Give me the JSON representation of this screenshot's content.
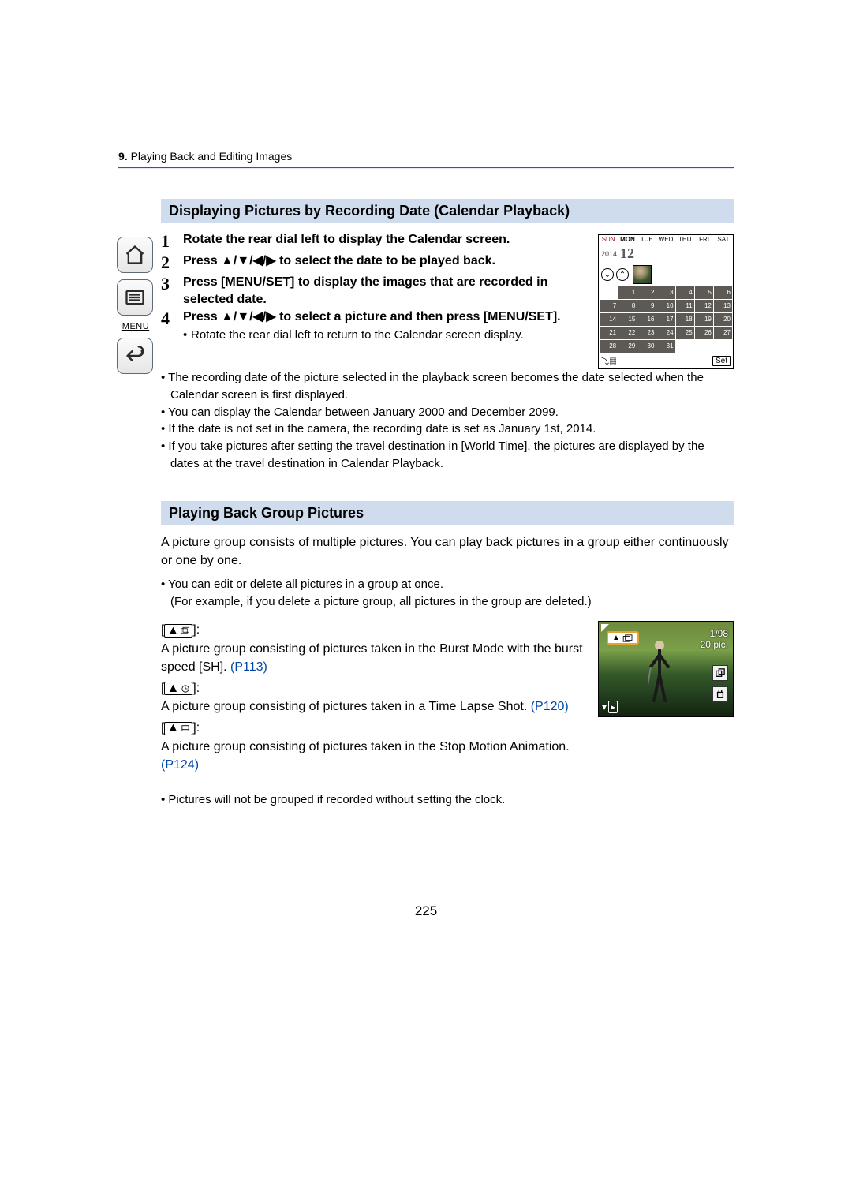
{
  "header": {
    "chapter_num": "9.",
    "chapter_title": "Playing Back and Editing Images"
  },
  "sidebar": {
    "menu_label": "MENU"
  },
  "section1": {
    "title": "Displaying Pictures by Recording Date (Calendar Playback)",
    "steps": [
      {
        "n": "1",
        "text": "Rotate the rear dial left to display the Calendar screen."
      },
      {
        "n": "2",
        "text": "Press ▲/▼/◀/▶ to select the date to be played back."
      },
      {
        "n": "3",
        "text": "Press [MENU/SET] to display the images that are recorded in selected date."
      },
      {
        "n": "4",
        "text": "Press ▲/▼/◀/▶ to select a picture and then press [MENU/SET].",
        "sub": "Rotate the rear dial left to return to the Calendar screen display."
      }
    ],
    "notes": [
      "The recording date of the picture selected in the playback screen becomes the date selected when the Calendar screen is first displayed.",
      "You can display the Calendar between January 2000 and December 2099.",
      "If the date is not set in the camera, the recording date is set as January 1st, 2014.",
      "If you take pictures after setting the travel destination in [World Time], the pictures are displayed by the dates at the travel destination in Calendar Playback."
    ]
  },
  "calendar": {
    "dow": [
      "SUN",
      "MON",
      "TUE",
      "WED",
      "THU",
      "FRI",
      "SAT"
    ],
    "year": "2014",
    "month": "12",
    "cells": [
      "",
      "1",
      "2",
      "3",
      "4",
      "5",
      "6",
      "7",
      "8",
      "9",
      "10",
      "11",
      "12",
      "13",
      "14",
      "15",
      "16",
      "17",
      "18",
      "19",
      "20",
      "21",
      "22",
      "23",
      "24",
      "25",
      "26",
      "27",
      "28",
      "29",
      "30",
      "31",
      "",
      "",
      ""
    ],
    "set": "Set"
  },
  "section2": {
    "title": "Playing Back Group Pictures",
    "intro": "A picture group consists of multiple pictures. You can play back pictures in a group either continuously or one by one.",
    "note1": "You can edit or delete all pictures in a group at once.",
    "note1b": "(For example, if you delete a picture group, all pictures in the group are deleted.)",
    "g1a": "A picture group consisting of pictures taken in the Burst Mode with the burst speed [SH]. ",
    "g1ref": "(P113)",
    "g2a": "A picture group consisting of pictures taken in a Time Lapse Shot. ",
    "g2ref": "(P120)",
    "g3a": "A picture group consisting of pictures taken in the Stop Motion Animation. ",
    "g3ref": "(P124)",
    "note2": "Pictures will not be grouped if recorded without setting the clock."
  },
  "playfig": {
    "counter": "1/98",
    "pic_count": "20",
    "pic_label": "pic."
  },
  "page_number": "225"
}
